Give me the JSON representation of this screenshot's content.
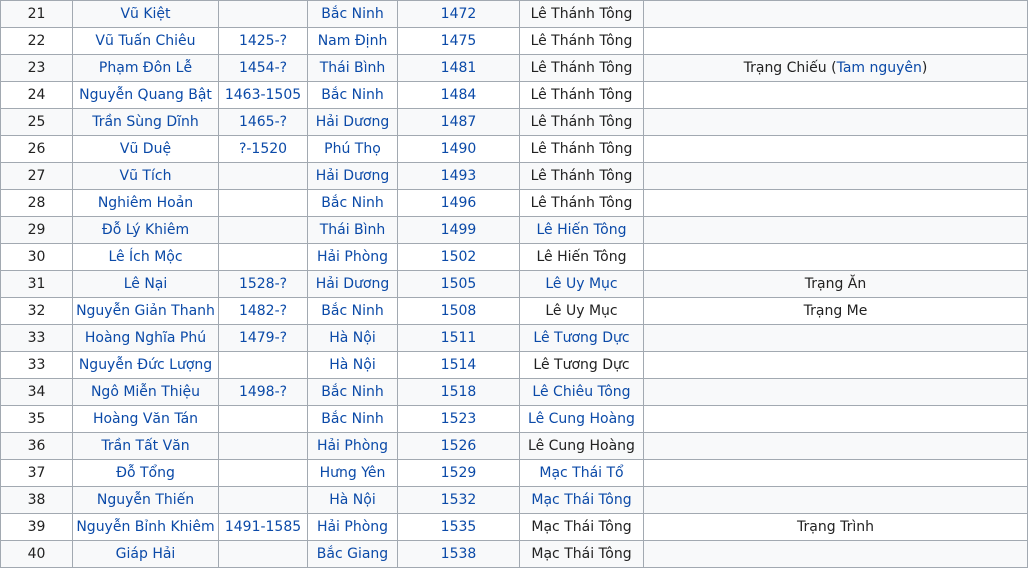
{
  "colors": {
    "link": "#0b4aa8",
    "text": "#222222",
    "border": "#a2a9b1",
    "row_odd": "#f8f9fa",
    "row_even": "#ffffff"
  },
  "rows": [
    {
      "no": "21",
      "name": "Vũ Kiệt",
      "life": "",
      "province": "Bắc Ninh",
      "year": "1472",
      "king": "Lê Thánh Tông",
      "king_link": false,
      "note": ""
    },
    {
      "no": "22",
      "name": "Vũ Tuấn Chiêu",
      "life": "1425-?",
      "province": "Nam Định",
      "year": "1475",
      "king": "Lê Thánh Tông",
      "king_link": false,
      "note": ""
    },
    {
      "no": "23",
      "name": "Phạm Đôn Lễ",
      "life": "1454-?",
      "province": "Thái Bình",
      "year": "1481",
      "king": "Lê Thánh Tông",
      "king_link": false,
      "note": "Trạng Chiếu (",
      "note_link": "Tam nguyên",
      "note_end": ")"
    },
    {
      "no": "24",
      "name": "Nguyễn Quang Bật",
      "life": "1463-1505",
      "province": "Bắc Ninh",
      "year": "1484",
      "king": "Lê Thánh Tông",
      "king_link": false,
      "note": ""
    },
    {
      "no": "25",
      "name": "Trần Sùng Dĩnh",
      "life": "1465-?",
      "province": "Hải Dương",
      "year": "1487",
      "king": "Lê Thánh Tông",
      "king_link": false,
      "note": ""
    },
    {
      "no": "26",
      "name": "Vũ Duệ",
      "life": "?-1520",
      "province": "Phú Thọ",
      "year": "1490",
      "king": "Lê Thánh Tông",
      "king_link": false,
      "note": ""
    },
    {
      "no": "27",
      "name": "Vũ Tích",
      "life": "",
      "province": "Hải Dương",
      "year": "1493",
      "king": "Lê Thánh Tông",
      "king_link": false,
      "note": ""
    },
    {
      "no": "28",
      "name": "Nghiêm Hoản",
      "life": "",
      "province": "Bắc Ninh",
      "year": "1496",
      "king": "Lê Thánh Tông",
      "king_link": false,
      "note": ""
    },
    {
      "no": "29",
      "name": "Đỗ Lý Khiêm",
      "life": "",
      "province": "Thái Bình",
      "year": "1499",
      "king": "Lê Hiến Tông",
      "king_link": true,
      "note": ""
    },
    {
      "no": "30",
      "name": "Lê Ích Mộc",
      "life": "",
      "province": "Hải Phòng",
      "year": "1502",
      "king": "Lê Hiến Tông",
      "king_link": false,
      "note": ""
    },
    {
      "no": "31",
      "name": "Lê Nại",
      "life": "1528-?",
      "province": "Hải Dương",
      "year": "1505",
      "king": "Lê Uy Mục",
      "king_link": true,
      "note": "Trạng Ăn"
    },
    {
      "no": "32",
      "name": "Nguyễn Giản Thanh",
      "life": "1482-?",
      "province": "Bắc Ninh",
      "year": "1508",
      "king": "Lê Uy Mục",
      "king_link": false,
      "note": "Trạng Me"
    },
    {
      "no": "33",
      "name": "Hoàng Nghĩa Phú",
      "life": "1479-?",
      "province": "Hà Nội",
      "year": "1511",
      "king": "Lê Tương Dực",
      "king_link": true,
      "note": ""
    },
    {
      "no": "33",
      "name": "Nguyễn Đức Lượng",
      "life": "",
      "province": "Hà Nội",
      "year": "1514",
      "king": "Lê Tương Dực",
      "king_link": false,
      "note": ""
    },
    {
      "no": "34",
      "name": "Ngô Miễn Thiệu",
      "life": "1498-?",
      "province": "Bắc Ninh",
      "year": "1518",
      "king": "Lê Chiêu Tông",
      "king_link": true,
      "note": ""
    },
    {
      "no": "35",
      "name": "Hoàng Văn Tán",
      "life": "",
      "province": "Bắc Ninh",
      "year": "1523",
      "king": "Lê Cung Hoàng",
      "king_link": true,
      "note": ""
    },
    {
      "no": "36",
      "name": "Trần Tất Văn",
      "life": "",
      "province": "Hải Phòng",
      "year": "1526",
      "king": "Lê Cung Hoàng",
      "king_link": false,
      "note": ""
    },
    {
      "no": "37",
      "name": "Đỗ Tổng",
      "life": "",
      "province": "Hưng Yên",
      "year": "1529",
      "king": "Mạc Thái Tổ",
      "king_link": true,
      "note": ""
    },
    {
      "no": "38",
      "name": "Nguyễn Thiến",
      "life": "",
      "province": "Hà Nội",
      "year": "1532",
      "king": "Mạc Thái Tông",
      "king_link": true,
      "note": ""
    },
    {
      "no": "39",
      "name": "Nguyễn Bỉnh Khiêm",
      "life": "1491-1585",
      "province": "Hải Phòng",
      "year": "1535",
      "king": "Mạc Thái Tông",
      "king_link": false,
      "note": "Trạng Trình"
    },
    {
      "no": "40",
      "name": "Giáp Hải",
      "life": "",
      "province": "Bắc Giang",
      "year": "1538",
      "king": "Mạc Thái Tông",
      "king_link": false,
      "note": ""
    }
  ]
}
